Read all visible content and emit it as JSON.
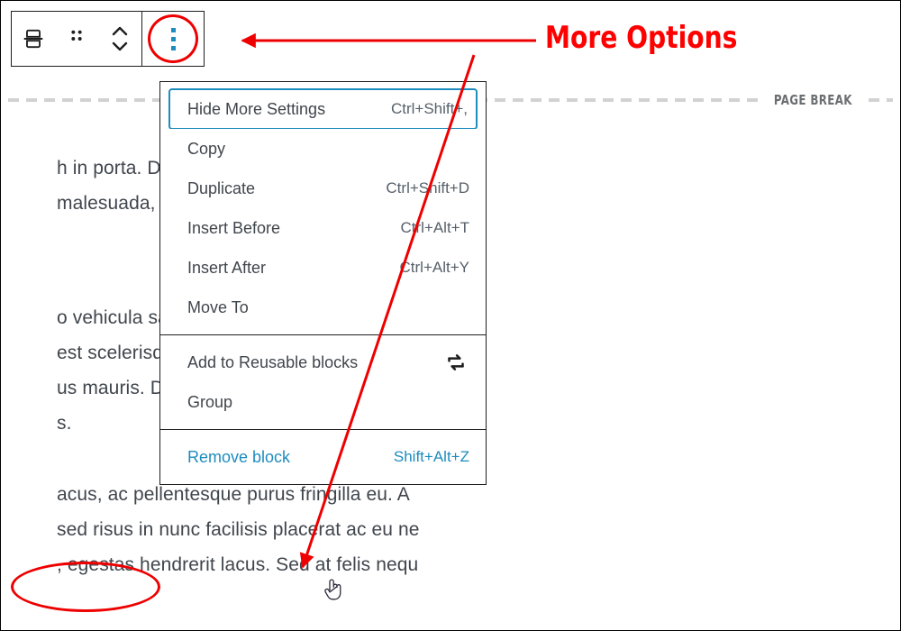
{
  "editor": {
    "page_break_label": "PAGE BREAK",
    "paragraphs": [
      "h in porta. Donec dictum justo vel est pret\nmalesuada, ultricies nisl eget, ultricies nibh",
      "o vehicula sapien suscipit sit amet. Vestibu\nest scelerisque et. Sed placerat sem vitae\nus mauris. Duis ullamcorper magna quis n\ns.",
      "acus, ac pellentesque purus fringilla eu. A\nsed risus in nunc facilisis placerat ac eu ne\n, egestas hendrerit lacus. Sed at felis nequ"
    ]
  },
  "toolbar": {
    "block_type_icon": "page-break-block-icon",
    "drag_handle_icon": "drag-handle-icon",
    "move_icon": "move-up-down-icon",
    "more_options_icon": "more-options-kebab-icon"
  },
  "menu": {
    "sections": [
      {
        "items": [
          {
            "label": "Hide More Settings",
            "shortcut": "Ctrl+Shift+,",
            "focused": true,
            "danger": false,
            "icon": ""
          },
          {
            "label": "Copy",
            "shortcut": "",
            "focused": false,
            "danger": false,
            "icon": ""
          },
          {
            "label": "Duplicate",
            "shortcut": "Ctrl+Shift+D",
            "focused": false,
            "danger": false,
            "icon": ""
          },
          {
            "label": "Insert Before",
            "shortcut": "Ctrl+Alt+T",
            "focused": false,
            "danger": false,
            "icon": ""
          },
          {
            "label": "Insert After",
            "shortcut": "Ctrl+Alt+Y",
            "focused": false,
            "danger": false,
            "icon": ""
          },
          {
            "label": "Move To",
            "shortcut": "",
            "focused": false,
            "danger": false,
            "icon": ""
          }
        ]
      },
      {
        "items": [
          {
            "label": "Add to Reusable blocks",
            "shortcut": "",
            "focused": false,
            "danger": false,
            "icon": "reusable-blocks-icon"
          },
          {
            "label": "Group",
            "shortcut": "",
            "focused": false,
            "danger": false,
            "icon": ""
          }
        ]
      },
      {
        "items": [
          {
            "label": "Remove block",
            "shortcut": "Shift+Alt+Z",
            "focused": false,
            "danger": true,
            "icon": ""
          }
        ]
      }
    ]
  },
  "annotations": {
    "more_options_callout": "More Options",
    "highlight_color": "#ee0000",
    "accent_color": "#1e8cbe"
  }
}
